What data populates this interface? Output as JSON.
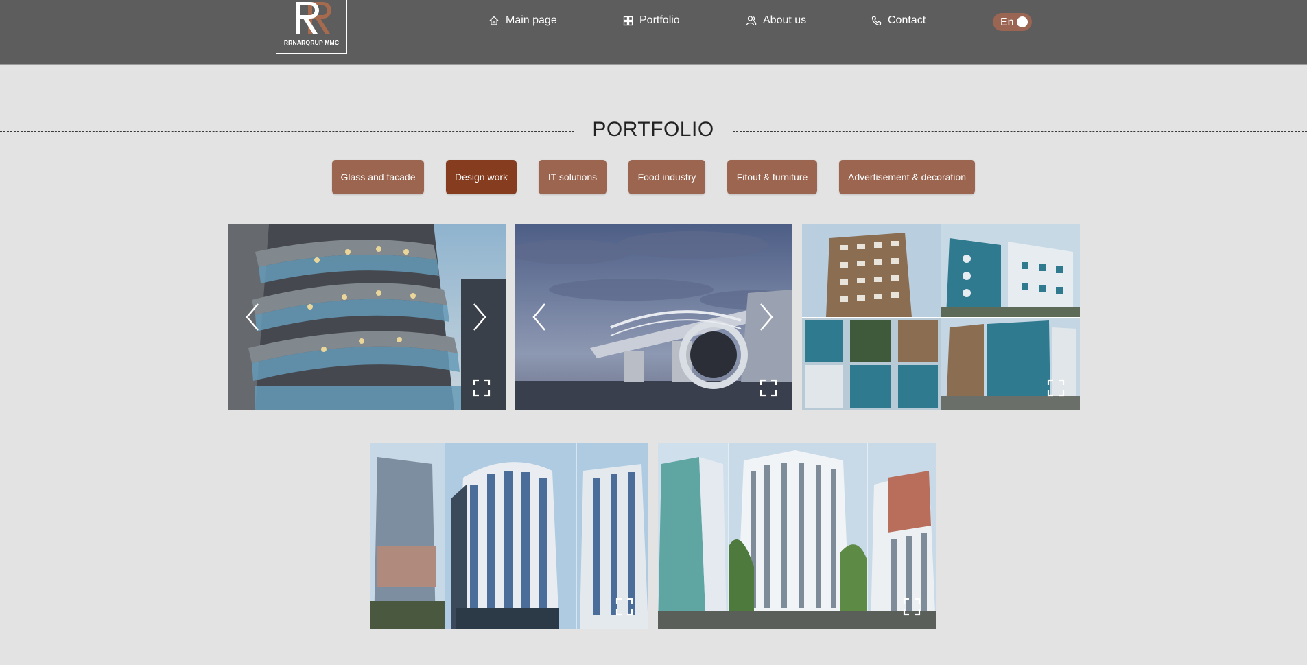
{
  "header": {
    "logo": {
      "text": "RRNARQRUP MMC"
    },
    "nav": [
      {
        "label": "Main page",
        "icon": "home-icon"
      },
      {
        "label": "Portfolio",
        "icon": "grid-icon"
      },
      {
        "label": "About us",
        "icon": "users-icon"
      },
      {
        "label": "Contact",
        "icon": "phone-icon"
      }
    ],
    "language": {
      "label": "En"
    }
  },
  "portfolio": {
    "title": "PORTFOLIO",
    "tabs": [
      {
        "label": "Glass and facade",
        "active": false
      },
      {
        "label": "Design work",
        "active": true
      },
      {
        "label": "IT solutions",
        "active": false
      },
      {
        "label": "Food industry",
        "active": false
      },
      {
        "label": "Fitout & furniture",
        "active": false
      },
      {
        "label": "Advertisement & decoration",
        "active": false
      }
    ]
  },
  "colors": {
    "header_bg": "#5d5d5d",
    "page_bg": "#e3e3e3",
    "tab_bg": "#9b6550",
    "tab_active_bg": "#853c1f",
    "accent": "#a66a4f"
  },
  "icons": {
    "prev": "chevron-left-icon",
    "next": "chevron-right-icon",
    "expand": "expand-icon"
  }
}
